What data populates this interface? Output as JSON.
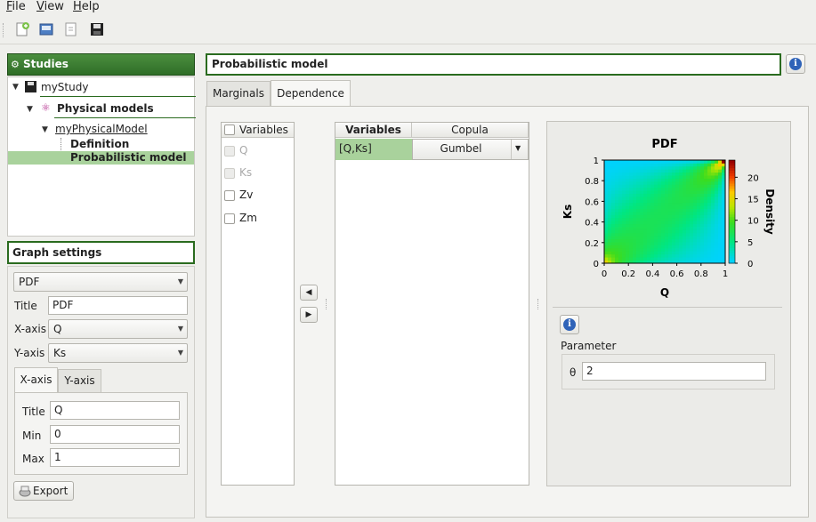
{
  "menu": [
    "File",
    "View",
    "Help"
  ],
  "toolbar": {
    "icons": [
      "new-study-icon",
      "open-study-icon",
      "import-python-icon",
      "save-icon"
    ]
  },
  "studies": {
    "header": "Studies",
    "tree": {
      "study": "myStudy",
      "physical_models": "Physical models",
      "model": "myPhysicalModel",
      "definition": "Definition",
      "probabilistic": "Probabilistic model"
    }
  },
  "graph_settings": {
    "header": "Graph settings",
    "plot_type": "PDF",
    "title_label": "Title",
    "title_value": "PDF",
    "xaxis_label": "X-axis",
    "xaxis_value": "Q",
    "yaxis_label": "Y-axis",
    "yaxis_value": "Ks",
    "tabs": [
      "X-axis",
      "Y-axis"
    ],
    "axis_title_label": "Title",
    "axis_title_value": "Q",
    "min_label": "Min",
    "min_value": "0",
    "max_label": "Max",
    "max_value": "1",
    "export_label": "Export"
  },
  "main": {
    "title": "Probabilistic model",
    "tabs": [
      "Marginals",
      "Dependence"
    ],
    "variables_header": "Variables",
    "variables": [
      {
        "name": "Q",
        "enabled": false
      },
      {
        "name": "Ks",
        "enabled": false
      },
      {
        "name": "Zv",
        "enabled": true
      },
      {
        "name": "Zm",
        "enabled": true
      }
    ],
    "copula_table": {
      "headers": [
        "Variables",
        "Copula"
      ],
      "rows": [
        {
          "variables": "[Q,Ks]",
          "copula": "Gumbel"
        }
      ]
    },
    "parameter_label": "Parameter",
    "theta_label": "θ",
    "theta_value": "2"
  },
  "chart_data": {
    "type": "heatmap",
    "title": "PDF",
    "xlabel": "Q",
    "ylabel": "Ks",
    "colorbar_label": "Density",
    "xlim": [
      0,
      1
    ],
    "ylim": [
      0,
      1
    ],
    "xticks": [
      "0",
      "0.2",
      "0.4",
      "0.6",
      "0.8",
      "1"
    ],
    "yticks": [
      "0",
      "0.2",
      "0.4",
      "0.6",
      "0.8",
      "1"
    ],
    "colorbar_ticks": [
      "0",
      "5",
      "10",
      "15",
      "20"
    ],
    "colorbar_range": [
      0,
      24
    ],
    "copula": "Gumbel",
    "theta": 2
  }
}
